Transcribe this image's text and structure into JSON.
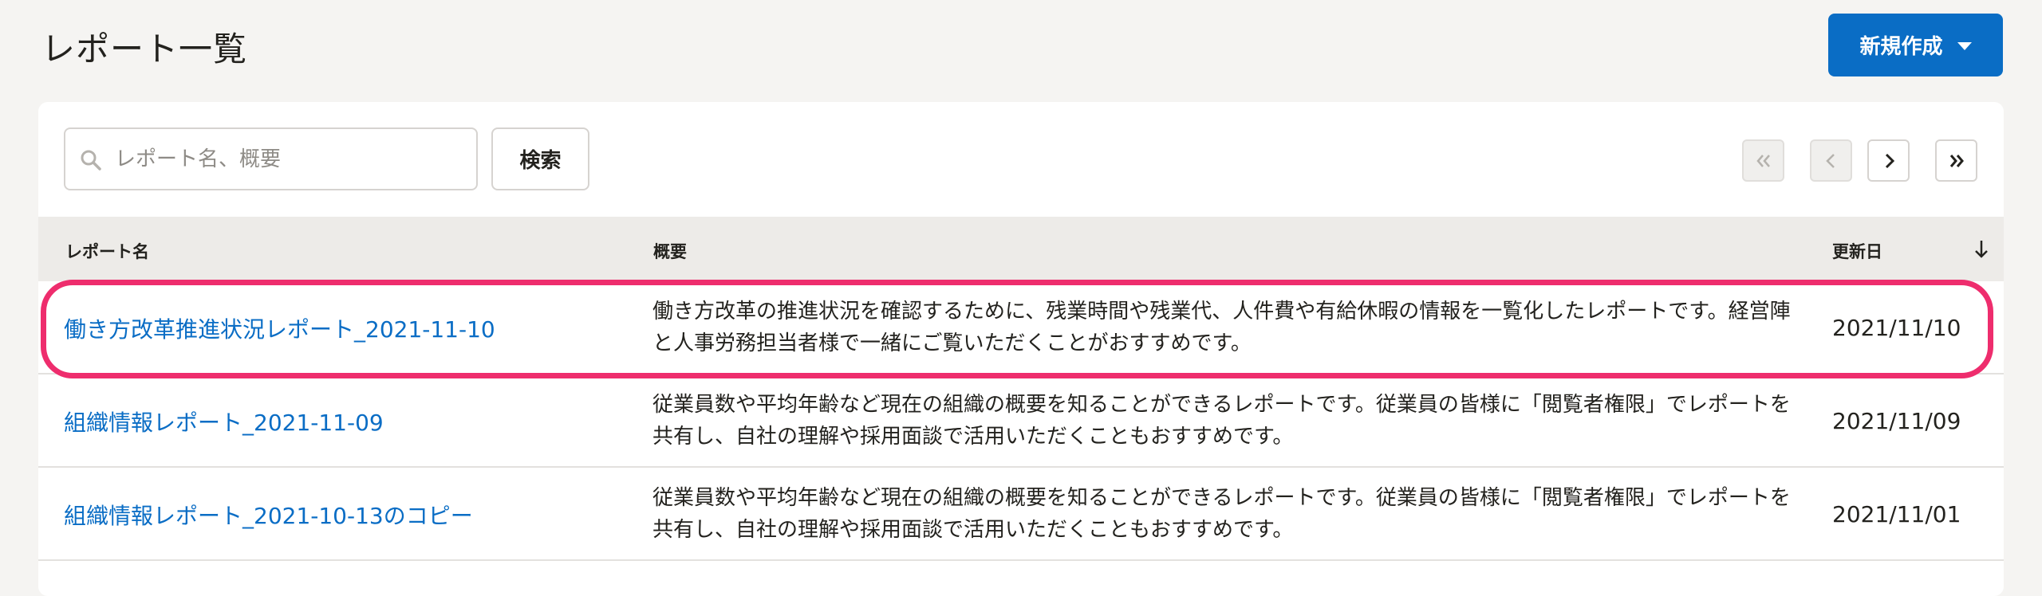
{
  "header": {
    "title": "レポート一覧",
    "new_button_label": "新規作成"
  },
  "search": {
    "placeholder": "レポート名、概要",
    "value": "",
    "button_label": "検索"
  },
  "pagination": {
    "first_enabled": false,
    "prev_enabled": false,
    "next_enabled": true,
    "last_enabled": true
  },
  "table": {
    "columns": [
      "レポート名",
      "概要",
      "更新日"
    ],
    "sort": {
      "column": "更新日",
      "direction": "descending"
    },
    "rows": [
      {
        "name": "働き方改革推進状況レポート_2021-11-10",
        "summary": "働き方改革の推進状況を確認するために、残業時間や残業代、人件費や有給休暇の情報を一覧化したレポートです。経営陣と人事労務担当者様で一緒にご覧いただくことがおすすめです。",
        "updated": "2021/11/10",
        "highlighted": true
      },
      {
        "name": "組織情報レポート_2021-11-09",
        "summary": "従業員数や平均年齢など現在の組織の概要を知ることができるレポートです。従業員の皆様に「閲覧者権限」でレポートを共有し、自社の理解や採用面談で活用いただくこともおすすめです。",
        "updated": "2021/11/09",
        "highlighted": false
      },
      {
        "name": "組織情報レポート_2021-10-13のコピー",
        "summary": "従業員数や平均年齢など現在の組織の概要を知ることができるレポートです。従業員の皆様に「閲覧者権限」でレポートを共有し、自社の理解や採用面談で活用いただくこともおすすめです。",
        "updated": "2021/11/01",
        "highlighted": false
      }
    ]
  },
  "colors": {
    "accent": "#0a6dc5",
    "highlight": "#ee2d6d",
    "background": "#f5f4f2",
    "header_row": "#edebe8"
  },
  "icons": {
    "search": "search-icon",
    "dropdown": "chevron-down-icon",
    "first": "double-chevron-left-icon",
    "prev": "chevron-left-icon",
    "next": "chevron-right-icon",
    "last": "double-chevron-right-icon",
    "sort": "arrow-down-icon"
  }
}
